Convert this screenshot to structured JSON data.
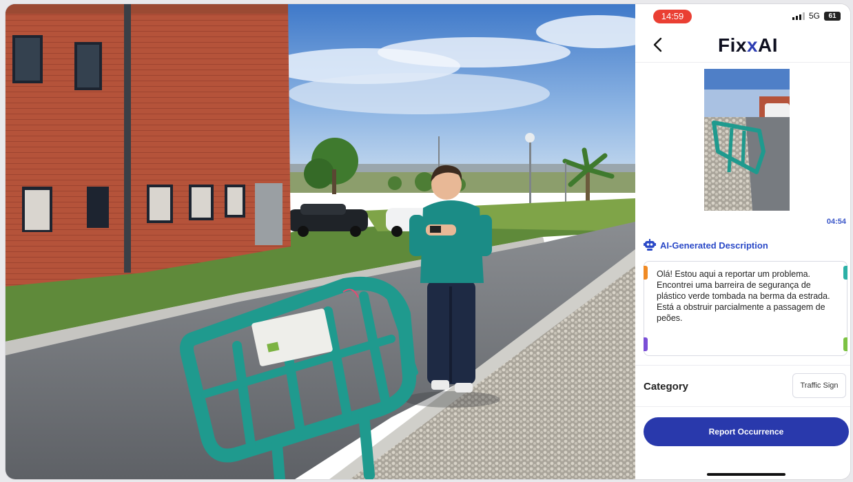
{
  "status_bar": {
    "time": "14:59",
    "network": "5G",
    "battery": "61"
  },
  "header": {
    "logo_fix": "Fix",
    "logo_x": "x",
    "logo_ai": "AI",
    "back_icon": "chevron-left-icon"
  },
  "media": {
    "duration": "04:54"
  },
  "ai_section": {
    "icon": "robot-icon",
    "label": "AI-Generated Description",
    "description": "Olá! Estou aqui a reportar um problema. Encontrei uma barreira de segurança de plástico verde tombada na berma da estrada. Está a obstruir parcialmente a passagem de peões."
  },
  "category": {
    "label": "Category",
    "value": "Traffic Sign"
  },
  "actions": {
    "report_label": "Report Occurrence"
  },
  "colors": {
    "accent": "#2939ac",
    "link": "#2a49c7",
    "status_red": "#ea3f33"
  }
}
